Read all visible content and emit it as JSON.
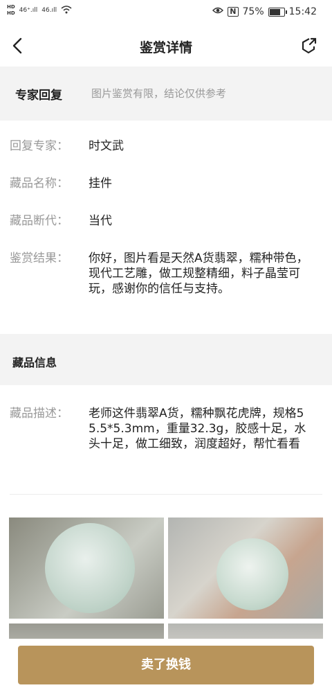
{
  "status_bar": {
    "hd1": "HD",
    "hd2": "HD",
    "sig1": "46⁺.ıll",
    "sig2": "46.ıll",
    "nfc": "N",
    "battery_text": "75%",
    "battery_level": 0.75,
    "time": "15:42"
  },
  "nav": {
    "title": "鉴赏详情",
    "back_icon": "chevron-left-icon",
    "share_icon": "share-icon"
  },
  "expert_section": {
    "heading": "专家回复",
    "subtitle": "图片鉴赏有限，结论仅供参考"
  },
  "details": {
    "expert_label": "回复专家：",
    "expert_value": "时文武",
    "name_label": "藏品名称：",
    "name_value": "挂件",
    "era_label": "藏品断代：",
    "era_value": "当代",
    "result_label": "鉴赏结果：",
    "result_value": "你好，图片看是天然A货翡翠，糯种带色，现代工艺雕，做工规整精细，料子晶莹可玩，感谢你的信任与支持。"
  },
  "collection_section": {
    "heading": "藏品信息",
    "desc_label": "藏品描述：",
    "desc_value": "老师这件翡翠A货，糯种飘花虎牌，规格55.5*5.3mm，重量32.3g，胶感十足，水头十足，做工细致，润度超好，帮忙看看"
  },
  "footer": {
    "sell_button": "卖了换钱"
  },
  "colors": {
    "accent": "#b8945b",
    "band_bg": "#f3f3f3",
    "label": "#999999"
  }
}
